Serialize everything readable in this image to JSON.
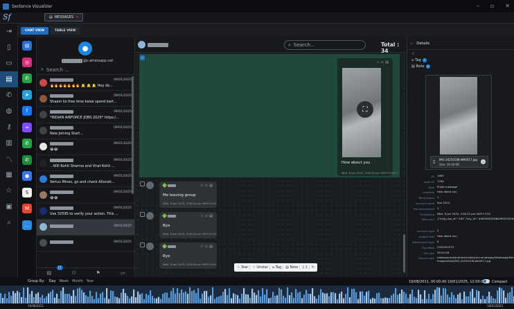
{
  "window": {
    "title": "Sectence Visualizer",
    "logo_text": "Sf",
    "controls": [
      "–",
      "▫",
      "✕"
    ]
  },
  "header": {
    "tab_label": "MESSAGES",
    "tab_close": "✕"
  },
  "view_tabs": [
    {
      "label": "CHAT VIEW",
      "active": true
    },
    {
      "label": "TABLE VIEW",
      "active": false
    }
  ],
  "left_nav": [
    "login-icon",
    "document-icon",
    "folder-icon",
    "chat-icon",
    "phone-icon",
    "globe-icon",
    "key-icon",
    "map-icon",
    "trend-icon",
    "notes-icon",
    "star-icon",
    "device-icon",
    "search-icon"
  ],
  "apps": [
    {
      "name": "messages-app-icon",
      "glyph": "▤",
      "color": "#2d6fd0"
    },
    {
      "name": "instagram-app-icon",
      "glyph": "◎",
      "color": "#d6307a"
    },
    {
      "name": "whatsapp-app-icon",
      "glyph": "✆",
      "color": "#25a244"
    },
    {
      "name": "telegram-app-icon",
      "glyph": "➤",
      "color": "#2a9fd8"
    },
    {
      "name": "facebook-app-icon",
      "glyph": "f",
      "color": "#1877f2"
    },
    {
      "name": "messenger-app-icon",
      "glyph": "≈",
      "color": "#7b4dff"
    },
    {
      "name": "whatsapp-business-app-icon",
      "glyph": "✆",
      "color": "#25a244"
    },
    {
      "name": "whatsapp-alt-app-icon",
      "glyph": "✆",
      "color": "#1f8a3c"
    },
    {
      "name": "signal-app-icon",
      "glyph": "●",
      "color": "#3a76f0"
    },
    {
      "name": "skype-app-icon",
      "glyph": "S",
      "color": "#f2f2f2"
    },
    {
      "name": "gmail-app-icon",
      "glyph": "M",
      "color": "#e84335"
    },
    {
      "name": "chat-app-icon",
      "glyph": "…",
      "color": "#2d8ae0"
    }
  ],
  "conversation_panel": {
    "account_suffix": "@s.whatsapp.net",
    "search_placeholder": "Search ...",
    "badge": "17",
    "items": [
      {
        "date": "09/01/2025",
        "preview": "🔥🔥🔥🔥🔥🔥🔥 🔔 🔔 🔔 Hey do...",
        "avatar_color": "#c94a4a",
        "selected": false
      },
      {
        "date": "09/01/2025",
        "preview": "Shaam ko free time kaise spend kart...",
        "avatar_color": "#8a5a3a",
        "selected": false
      },
      {
        "date": "09/01/2025",
        "preview": "*INDIAN AIRFORCE JOBS 2025* https:/...",
        "avatar_color": "#404448",
        "selected": false
      },
      {
        "date": "09/01/2025",
        "preview": "New Joining Start...",
        "avatar_color": "#404448",
        "selected": false
      },
      {
        "date": "09/01/2025",
        "preview": "😂😂",
        "avatar_color": "#e8e8e8",
        "selected": false
      },
      {
        "date": "09/01/2025",
        "preview": "...Will Rohit Sharma and Virat Kohli ...",
        "avatar_color": "#202226",
        "selected": false
      },
      {
        "date": "09/01/2025",
        "preview": "Vertus Mines, go and check Allocati...",
        "avatar_color": "#2f7ad8",
        "selected": false
      },
      {
        "date": "09/01/2025",
        "preview": "😂😂",
        "avatar_color": "#9a7a62",
        "selected": false
      },
      {
        "date": "09/01/2025",
        "preview": "Use 32595 to verify your action. This ...",
        "avatar_color": "#1a2a6a",
        "selected": false
      },
      {
        "date": "09/01/2025",
        "preview": "",
        "avatar_color": "#8fb6d6",
        "selected": true
      },
      {
        "date": "09/01/2025",
        "preview": "",
        "avatar_color": "#4a4e54",
        "selected": false
      }
    ]
  },
  "chat": {
    "search_placeholder": "Search...",
    "total_label": "Total : 34",
    "big_message": {
      "text": "How about you",
      "meta": "Wed, 8 Jan 2025, 3:28:32 pm GMT+5:30",
      "status": "✓"
    },
    "messages": [
      {
        "text": "Me leaving group",
        "meta": "Wed, 8 Jan 2025, 3:28:40 pm GMT+5:30"
      },
      {
        "text": "Bye",
        "meta": "Wed, 8 Jan 2025, 3:29:44 pm GMT+5:30"
      },
      {
        "text": "Bye",
        "meta": "Wed, 8 Jan 2025, 3:29:46 pm GMT+5:30"
      }
    ],
    "actions": [
      "☆ Star",
      "☆ Unstar",
      "⌂ Tag",
      "▤ Note",
      "▯ 1",
      "↻"
    ]
  },
  "details": {
    "title": "Details",
    "tag_label": "Tag",
    "note_label": "Note",
    "file_name": "IMG-20250108-WA0017.jpg",
    "file_size": "Size: 39.04 KB",
    "props": [
      {
        "k": "ID",
        "v": "1683"
      },
      {
        "k": "Audit ID",
        "v": "1764"
      },
      {
        "k": "Type",
        "v": "Photo message"
      },
      {
        "k": "Contents",
        "v": "How about you"
      },
      {
        "k": "Read status",
        "v": "1"
      },
      {
        "k": "Account name",
        "v": "Soo 2024"
      },
      {
        "k": "Has attachment",
        "v": "1"
      },
      {
        "k": "Timestamp",
        "v": "Wed, 8 Jan 2025, 3:28:32 pm GMT+5:30"
      },
      {
        "k": "Meta json",
        "v": "{\"msg_row_id\":\"162\",\"key_id\":\"4483E0B1ED6AF6FDC5E4B0D8495B\",\"msg_type\":\"1\",\"sender_device_type\":\"android\"}"
      },
      {
        "k": "Account type",
        "v": "2"
      },
      {
        "k": "Quoted text",
        "v": "How about you"
      },
      {
        "k": "Attachment type",
        "v": "6"
      },
      {
        "k": "Zip offset",
        "v": "2355552373"
      },
      {
        "k": "File size",
        "v": "39.04 KB"
      },
      {
        "k": "Device path",
        "v": "/data/sdcard/android/media/com.whatsapp/WhatsApp/Media/WhatsApp Images/Sent/IMG-20250108-WA0017.jpg"
      }
    ]
  },
  "timeline": {
    "group_by_label": "Group By:",
    "groups": [
      {
        "label": "Day",
        "active": true
      },
      {
        "label": "Week",
        "active": false
      },
      {
        "label": "Month",
        "active": false
      },
      {
        "label": "Year",
        "active": false
      }
    ],
    "range_label": "19/08/2011, 00:00:00-10/01/2025, 12:00:00",
    "compact_label": "Compact",
    "start_label": "19/08/2011",
    "end_label": "10/01/2025"
  }
}
